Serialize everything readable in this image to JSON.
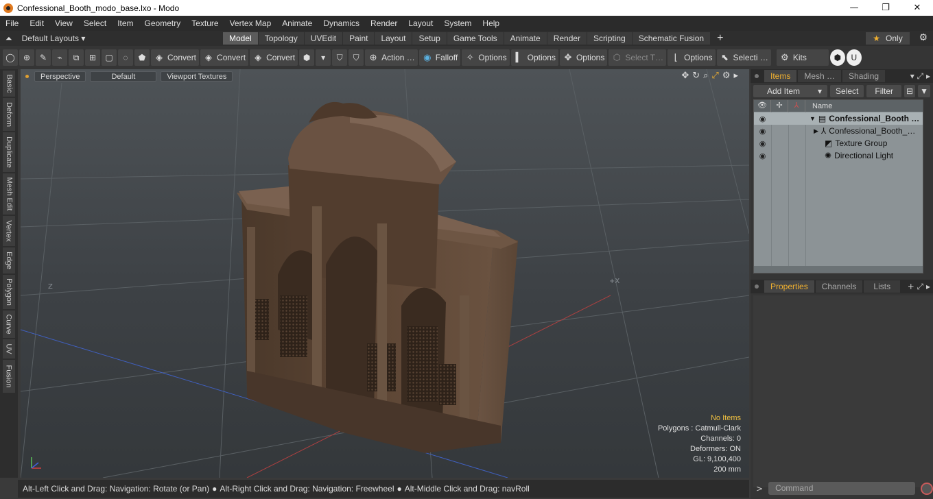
{
  "window": {
    "title": "Confessional_Booth_modo_base.lxo - Modo",
    "minimize": "—",
    "maximize": "❐",
    "close": "✕"
  },
  "menu": [
    "File",
    "Edit",
    "View",
    "Select",
    "Item",
    "Geometry",
    "Texture",
    "Vertex Map",
    "Animate",
    "Dynamics",
    "Render",
    "Layout",
    "System",
    "Help"
  ],
  "layouts": {
    "label": "Default Layouts ▾"
  },
  "tabs": [
    {
      "label": "Model",
      "active": true
    },
    {
      "label": "Topology"
    },
    {
      "label": "UVEdit"
    },
    {
      "label": "Paint"
    },
    {
      "label": "Layout"
    },
    {
      "label": "Setup"
    },
    {
      "label": "Game Tools"
    },
    {
      "label": "Animate"
    },
    {
      "label": "Render"
    },
    {
      "label": "Scripting"
    },
    {
      "label": "Schematic Fusion"
    }
  ],
  "tab_add": "+",
  "only": {
    "label": "Only"
  },
  "toolbar": {
    "convert1": "Convert",
    "convert2": "Convert",
    "convert3": "Convert",
    "action": "Action …",
    "falloff": "Falloff",
    "options1": "Options",
    "options2": "Options",
    "options3": "Options",
    "select_t": "Select T…",
    "options4": "Options",
    "selecti": "Selecti …",
    "kits": "Kits"
  },
  "left_tabs": [
    "Basic",
    "Deform",
    "Duplicate",
    "Mesh Edit",
    "Vertex",
    "Edge",
    "Polygon",
    "Curve",
    "UV",
    "Fusion"
  ],
  "viewport": {
    "perspective": "Perspective",
    "default": "Default",
    "textures": "Viewport Textures",
    "axis_z": "Z",
    "axis_x": "+X",
    "stats": {
      "no_items": "No Items",
      "polygons": "Polygons : Catmull-Clark",
      "channels": "Channels: 0",
      "deformers": "Deformers: ON",
      "gl": "GL: 9,100,400",
      "size": "200 mm"
    }
  },
  "status": {
    "a": "Alt-Left Click and Drag: Navigation: Rotate (or Pan)",
    "b": "Alt-Right Click and Drag: Navigation: Freewheel",
    "c": "Alt-Middle Click and Drag: navRoll"
  },
  "right": {
    "tabs1": [
      "Items",
      "Mesh …",
      "Shading"
    ],
    "add_item": "Add Item",
    "select": "Select",
    "filter": "Filter",
    "col_name": "Name",
    "items": [
      {
        "label": "Confessional_Booth …",
        "bold": true
      },
      {
        "label": "Confessional_Booth_…"
      },
      {
        "label": "Texture Group"
      },
      {
        "label": "Directional Light"
      }
    ],
    "tabs2": [
      "Properties",
      "Channels",
      "Lists"
    ],
    "command_placeholder": "Command"
  },
  "colors": {
    "accent": "#f0b030",
    "warn": "#f0c040"
  }
}
